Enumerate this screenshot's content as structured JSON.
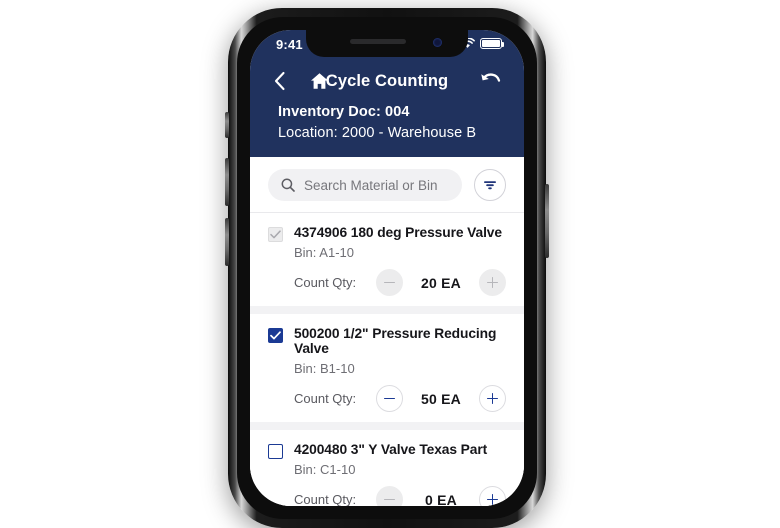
{
  "status_bar": {
    "time": "9:41",
    "signal_icon": "cellular-bars-icon",
    "wifi_icon": "wifi-icon",
    "battery_icon": "battery-full-icon"
  },
  "header": {
    "back_icon": "chevron-left-icon",
    "home_icon": "home-icon",
    "title": "Cycle Counting",
    "undo_icon": "undo-arrow-icon",
    "doc_line": "Inventory Doc: 004",
    "location_line": "Location: 2000 - Warehouse B",
    "background_color": "#20325e"
  },
  "search": {
    "placeholder": "Search Material or Bin",
    "value": "",
    "search_icon": "search-icon",
    "filter_icon": "filter-icon"
  },
  "list": {
    "qty_label": "Count Qty:",
    "minus_label": "−",
    "plus_label": "+",
    "items": [
      {
        "checkbox_state": "disabled-checked",
        "title": "4374906 180 deg Pressure Valve",
        "bin": "Bin: A1-10",
        "qty_value": "20 EA",
        "minus_enabled": false,
        "plus_enabled": false
      },
      {
        "checkbox_state": "checked",
        "title": "500200 1/2\" Pressure Reducing Valve",
        "bin": "Bin: B1-10",
        "qty_value": "50 EA",
        "minus_enabled": true,
        "plus_enabled": true
      },
      {
        "checkbox_state": "unchecked",
        "title": "4200480 3\" Y Valve Texas Part",
        "bin": "Bin: C1-10",
        "qty_value": "0 EA",
        "minus_enabled": false,
        "plus_enabled": true
      }
    ]
  },
  "colors": {
    "navy": "#20325e",
    "accent_blue": "#1b3a94",
    "disabled_gray": "#b6b6ba"
  }
}
